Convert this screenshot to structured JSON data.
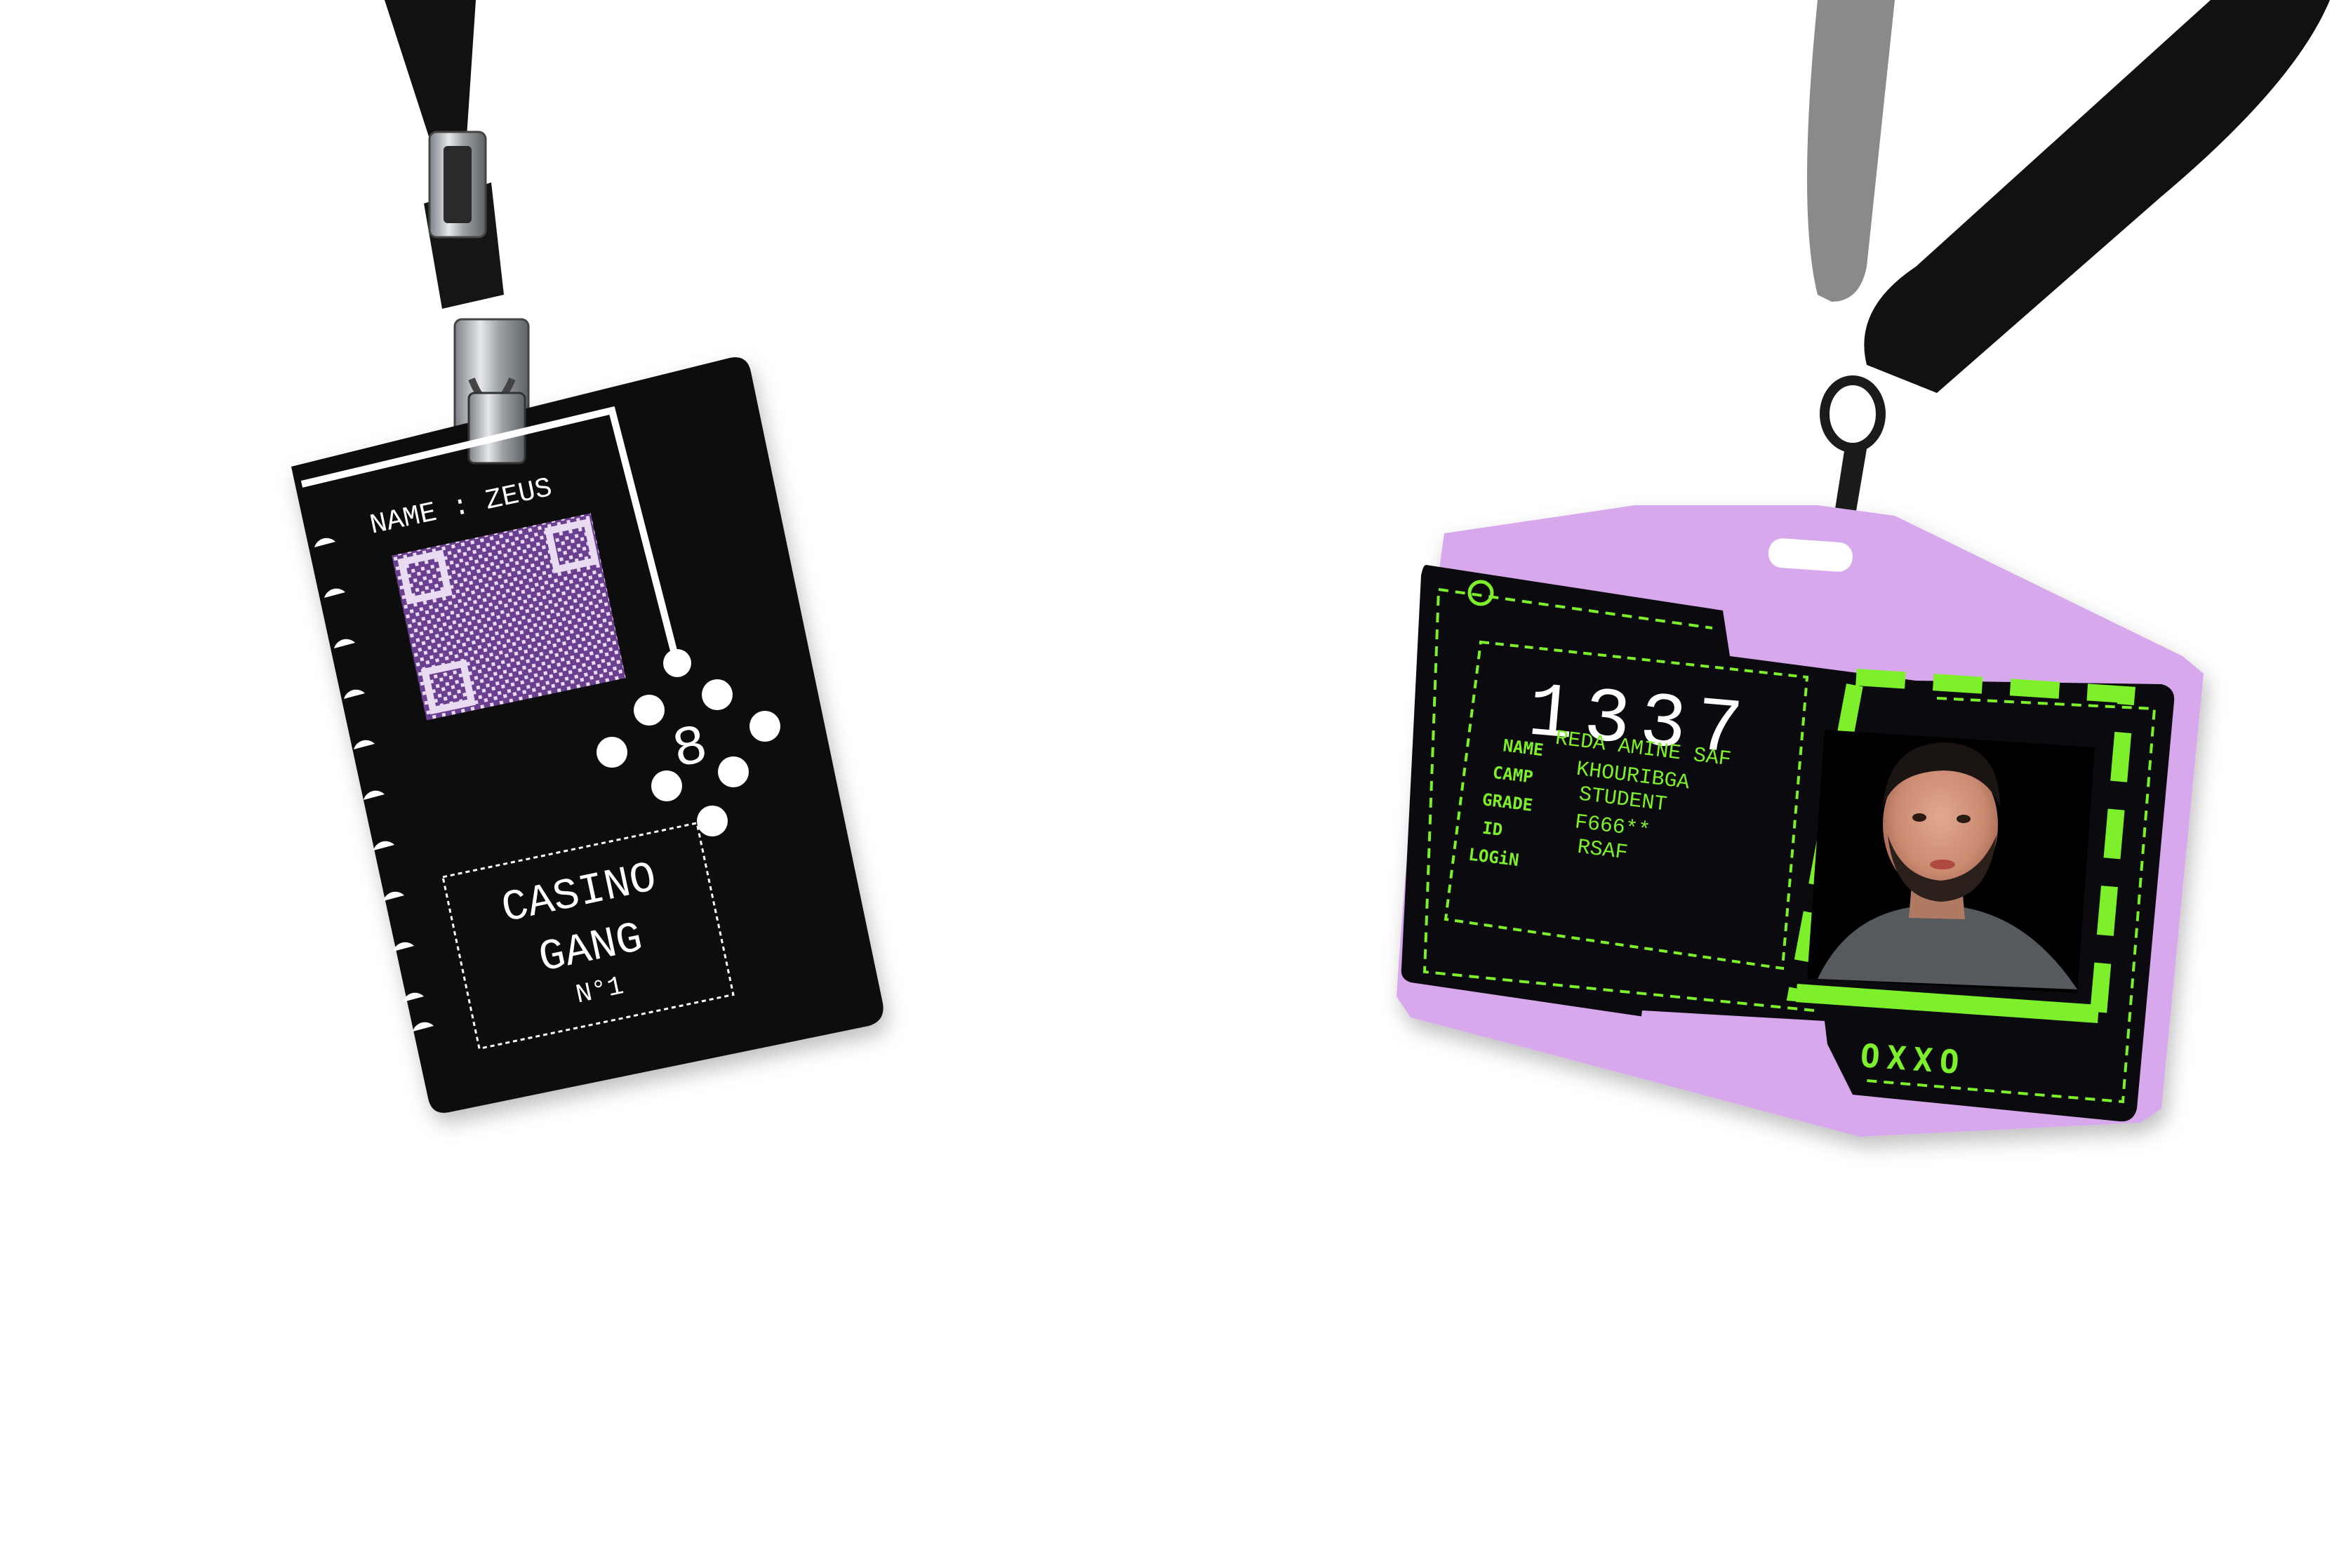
{
  "colors": {
    "background": "#ffffff",
    "card_black": "#0b0b0f",
    "qr_purple": "#6a3f8f",
    "badge_lilac": "#d8a8ec",
    "neon_green": "#7df02b",
    "lanyard_black": "#111111",
    "lanyard_gray": "#8a8a8a",
    "clip_metal": "#b9bcc0"
  },
  "badge_left": {
    "name_label": "NAME : ZEUS",
    "qr_label": "qr-code",
    "digit": "8",
    "brand_line1": "CASINO",
    "brand_line2": "GANG",
    "number": "N°1"
  },
  "badge_right": {
    "number": "1337",
    "fields": [
      {
        "label": "NAME",
        "value": "REDA AMINE SAF"
      },
      {
        "label": "CAMP",
        "value": "KHOURIBGA"
      },
      {
        "label": "GRADE",
        "value": "STUDENT"
      },
      {
        "label": "ID",
        "value": "F666**"
      },
      {
        "label": "LOGiN",
        "value": "RSAF"
      }
    ],
    "footer_code": "OXXO",
    "photo_subject": "portrait-photo"
  }
}
